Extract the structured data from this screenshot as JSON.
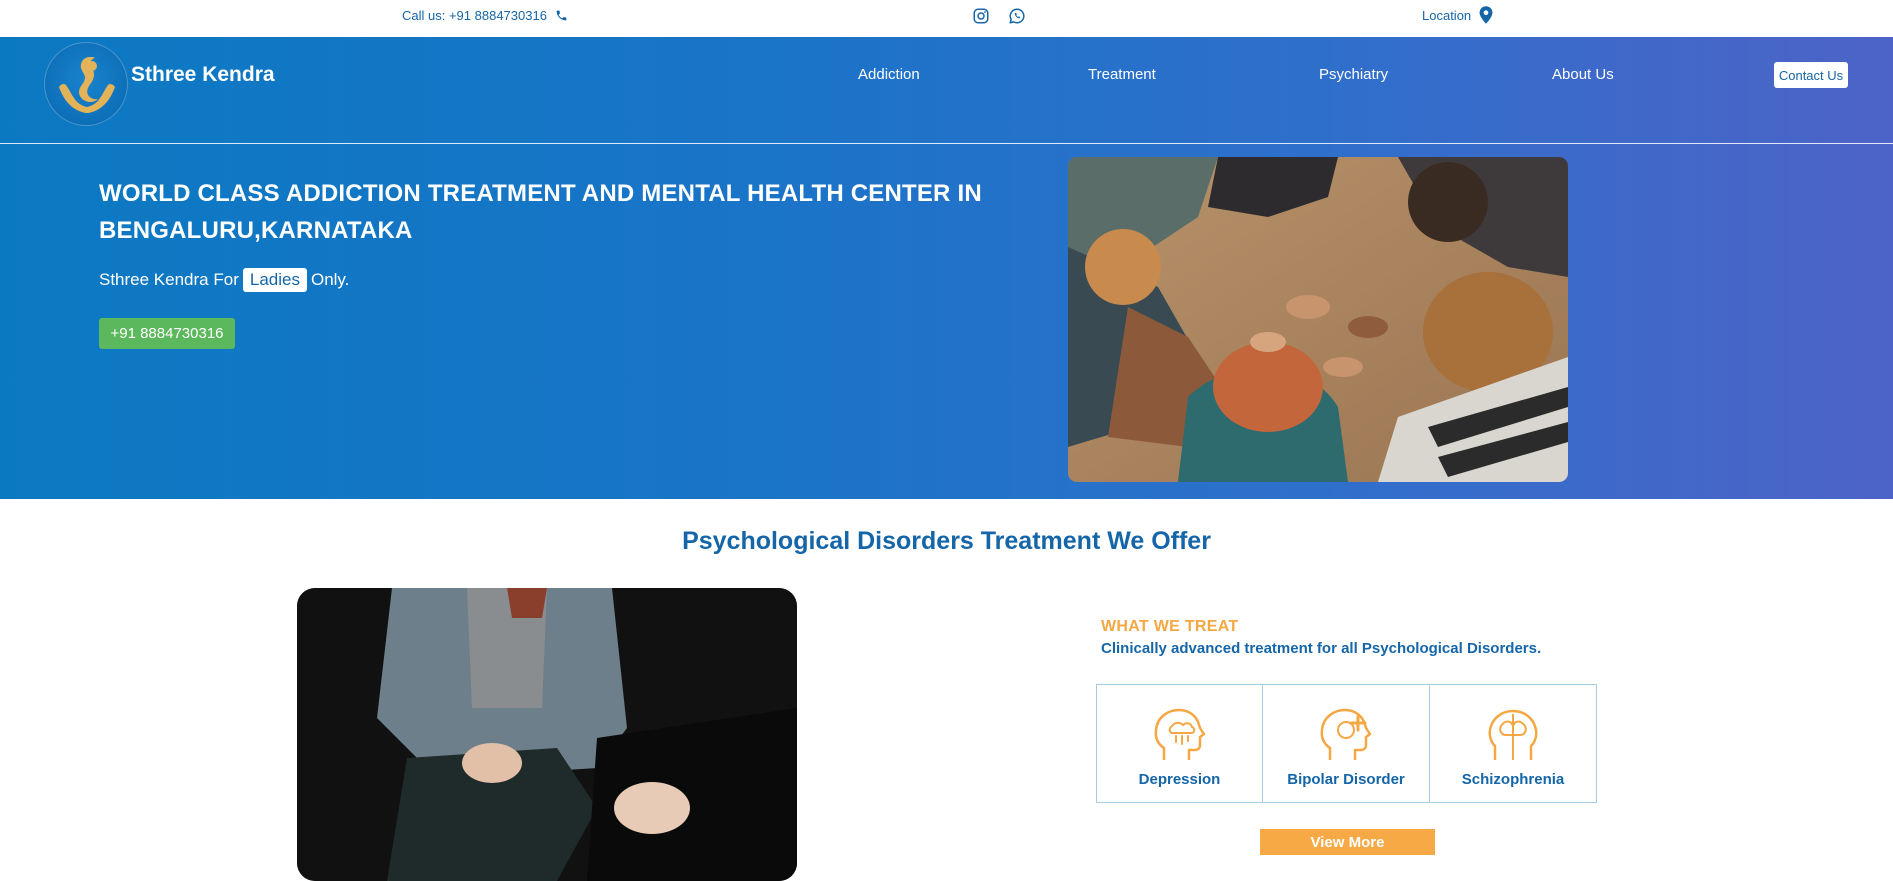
{
  "topbar": {
    "call_text": "Call us: +91 8884730316",
    "location_text": "Location",
    "icons": [
      "phone-icon",
      "instagram-icon",
      "whatsapp-icon",
      "map-pin-icon"
    ]
  },
  "nav": {
    "brand": "Sthree Kendra",
    "items": [
      {
        "label": "Addiction"
      },
      {
        "label": "Treatment"
      },
      {
        "label": "Psychiatry"
      },
      {
        "label": "About Us"
      }
    ],
    "contact_label": "Contact Us"
  },
  "hero": {
    "title": "WORLD CLASS ADDICTION TREATMENT AND MENTAL HEALTH CENTER IN BENGALURU,KARNATAKA",
    "subtitle_prefix": "Sthree Kendra For",
    "subtitle_highlight": "Ladies",
    "subtitle_suffix": "Only.",
    "phone_button": "+91 8884730316"
  },
  "section": {
    "title": "Psychological Disorders Treatment We Offer",
    "treat_label": "WHAT WE TREAT",
    "treat_desc": "Clinically advanced treatment for all Psychological Disorders.",
    "cards": [
      {
        "label": "Depression",
        "icon": "depression-head-icon"
      },
      {
        "label": "Bipolar Disorder",
        "icon": "bipolar-head-icon"
      },
      {
        "label": "Schizophrenia",
        "icon": "schizophrenia-head-icon"
      }
    ],
    "view_more": "View More"
  },
  "colors": {
    "primary_blue": "#1566a8",
    "gradient_start": "#0b79c2",
    "gradient_end": "#4d63c7",
    "accent_orange": "#f6a945",
    "green_button": "#5cb85c"
  }
}
